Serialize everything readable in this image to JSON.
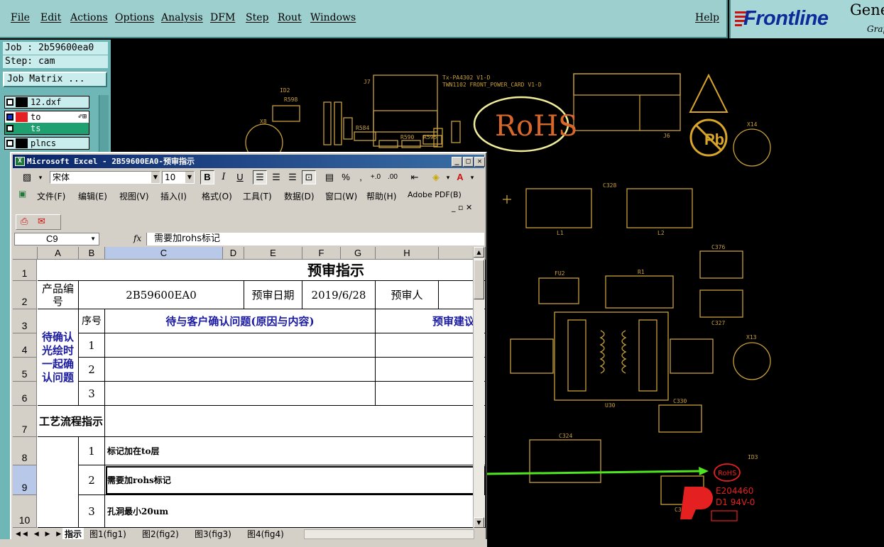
{
  "menubar": {
    "items": [
      "File",
      "Edit",
      "Actions",
      "Options",
      "Analysis",
      "DFM",
      "Step",
      "Rout",
      "Windows"
    ],
    "help": "Help"
  },
  "logo": {
    "brand": "Frontline",
    "suffix": "Gene",
    "sub": "Grap"
  },
  "left_panel": {
    "job": "Job : 2b59600ea0",
    "step": "Step: cam",
    "job_matrix": "Job Matrix ...",
    "layers": [
      {
        "name": "12.dxf",
        "color": "#000000"
      },
      {
        "name": "to",
        "color": "#e52020"
      },
      {
        "name": "ts",
        "color": "#1ea070"
      },
      {
        "name": "plncs",
        "color": "#000000"
      }
    ]
  },
  "pcb": {
    "rohs_big": "RoHS",
    "rohs_small": "RoHS",
    "ul_number": "E204460",
    "ul_grade": "D1  94V-0",
    "title_line1": "Tx-PA4302 V1-D",
    "title_line2": "TWN1102 FRONT_POWER_CARD V1-D",
    "refs": [
      "ID2",
      "R598",
      "X8",
      "R573",
      "R589",
      "FB17",
      "R584",
      "FB18",
      "R590",
      "R595",
      "R597",
      "R566",
      "R592",
      "J7",
      "J10",
      "J6",
      "X14",
      "C328",
      "L1",
      "L2",
      "C376",
      "FU2",
      "R1",
      "C327",
      "X13",
      "PS2",
      "JP3",
      "JP4",
      "PS1",
      "U30",
      "C330",
      "C324",
      "R575",
      "C329",
      "ID3",
      "Q24"
    ]
  },
  "excel": {
    "title": "Microsoft Excel - 2B59600EA0-预审指示",
    "font_name": "宋体",
    "font_size": "10",
    "menu": [
      "文件(F)",
      "编辑(E)",
      "视图(V)",
      "插入(I)",
      "格式(O)",
      "工具(T)",
      "数据(D)",
      "窗口(W)",
      "帮助(H)",
      "Adobe PDF(B)"
    ],
    "name_box": "C9",
    "formula": "需要加rohs标记",
    "columns": [
      "A",
      "B",
      "C",
      "D",
      "E",
      "F",
      "G",
      "H"
    ],
    "rows": [
      "1",
      "2",
      "3",
      "4",
      "5",
      "6",
      "7",
      "8",
      "9",
      "10"
    ],
    "cells": {
      "title": "预审指示",
      "product_label": "产品编号",
      "product_value": "2B59600EA0",
      "date_label": "预审日期",
      "date_value": "2019/6/28",
      "reviewer_label": "预审人",
      "seq_label": "序号",
      "issue_header": "待与客户确认问题(原因与内容)",
      "suggest_header": "预审建议",
      "pending_label": "待确认光绘时一起确认问题",
      "seq": [
        "1",
        "2",
        "3"
      ],
      "process_label": "工艺流程指示",
      "steps": [
        {
          "no": "1",
          "text": "标记加在to层"
        },
        {
          "no": "2",
          "text": "需要加rohs标记"
        },
        {
          "no": "3",
          "text": "孔洞最小20um"
        }
      ]
    },
    "sheet_tabs": [
      "指示",
      "图1(fig1)",
      "图2(fig2)",
      "图3(fig3)",
      "图4(fig4)"
    ]
  }
}
